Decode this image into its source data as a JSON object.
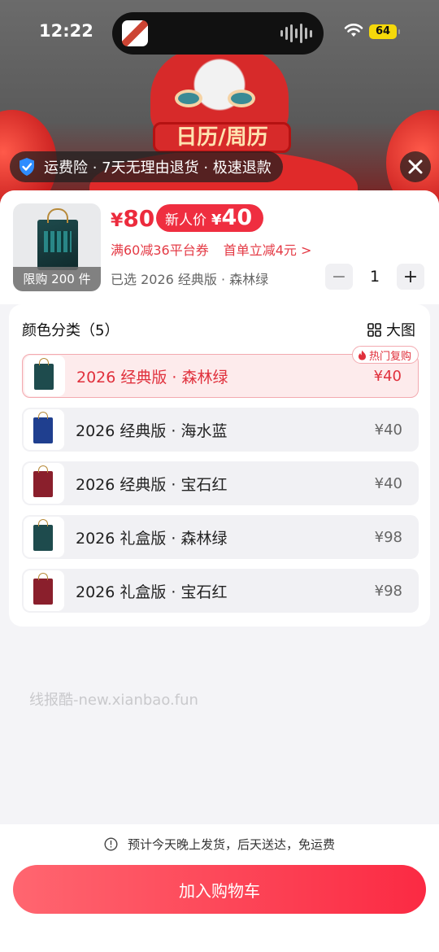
{
  "status_bar": {
    "time": "12:22",
    "battery": "64"
  },
  "banner": {
    "sign_text": "日历/周历"
  },
  "service_tag": {
    "text": "运费险 · 7天无理由退货 · 极速退款"
  },
  "product": {
    "limit_label": "限购 200 件",
    "price_symbol": "¥",
    "price": "80",
    "newbie_label": "新人价",
    "newbie_symbol": "¥",
    "newbie_price": "40",
    "coupon_1": "满60减36平台券",
    "coupon_2": "首单立减4元 >",
    "selected": "已选 2026 经典版 · 森林绿",
    "quantity": "1",
    "minus": "−",
    "plus": "+"
  },
  "options": {
    "title": "颜色分类（5）",
    "big_view": "大图",
    "hot_badge": "热门复购",
    "items": [
      {
        "name": "2026 经典版 · 森林绿",
        "price": "¥40",
        "color": "#1e4b4d"
      },
      {
        "name": "2026 经典版 · 海水蓝",
        "price": "¥40",
        "color": "#1f3f8f"
      },
      {
        "name": "2026 经典版 · 宝石红",
        "price": "¥40",
        "color": "#8a1f2c"
      },
      {
        "name": "2026 礼盒版 · 森林绿",
        "price": "¥98",
        "color": "#1e4b4d"
      },
      {
        "name": "2026 礼盒版 · 宝石红",
        "price": "¥98",
        "color": "#8a1f2c"
      }
    ]
  },
  "watermark": "线报酷-new.xianbao.fun",
  "footer": {
    "ship_note": "预计今天晚上发货，后天送达，免运费",
    "add_cart": "加入购物车"
  },
  "colors": {
    "accent": "#ec2b3d",
    "button_start": "#ff6670",
    "button_end": "#fb2a43"
  }
}
